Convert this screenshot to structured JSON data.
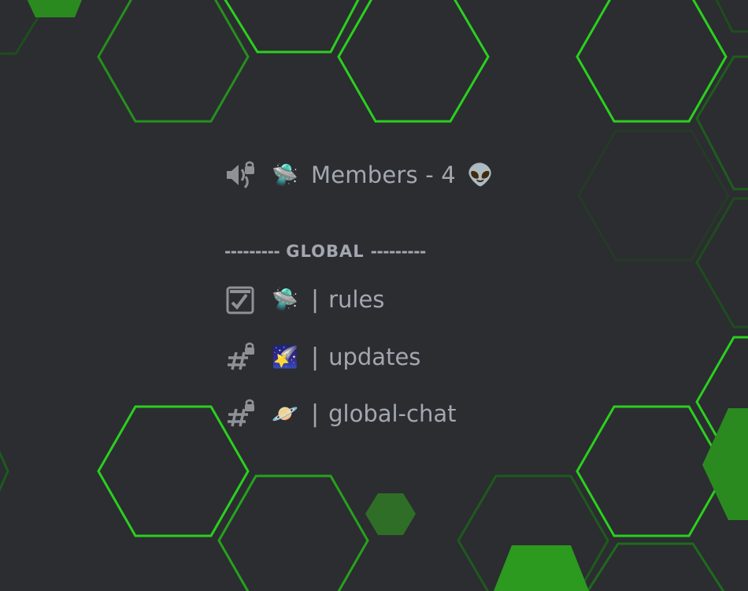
{
  "voice_channel": {
    "emoji": "🛸",
    "label": "Members - 4",
    "trailing_emoji": "👽"
  },
  "category": {
    "left_dashes": "---------",
    "title": "GLOBAL",
    "right_dashes": "---------"
  },
  "channels": [
    {
      "type": "rules",
      "emoji": "🛸",
      "separator": "|",
      "name": "rules"
    },
    {
      "type": "text-locked",
      "emoji": "🌠",
      "separator": "|",
      "name": "updates"
    },
    {
      "type": "text-locked",
      "emoji": "🪐",
      "separator": "|",
      "name": "global-chat"
    }
  ],
  "colors": {
    "background": "#2b2d31",
    "text": "#a3a7b0",
    "hex_bright": "#2ad01d",
    "hex_mid": "#269a1c",
    "hex_dim": "#1e5a1d",
    "hex_fill": "#2b8a1f"
  }
}
